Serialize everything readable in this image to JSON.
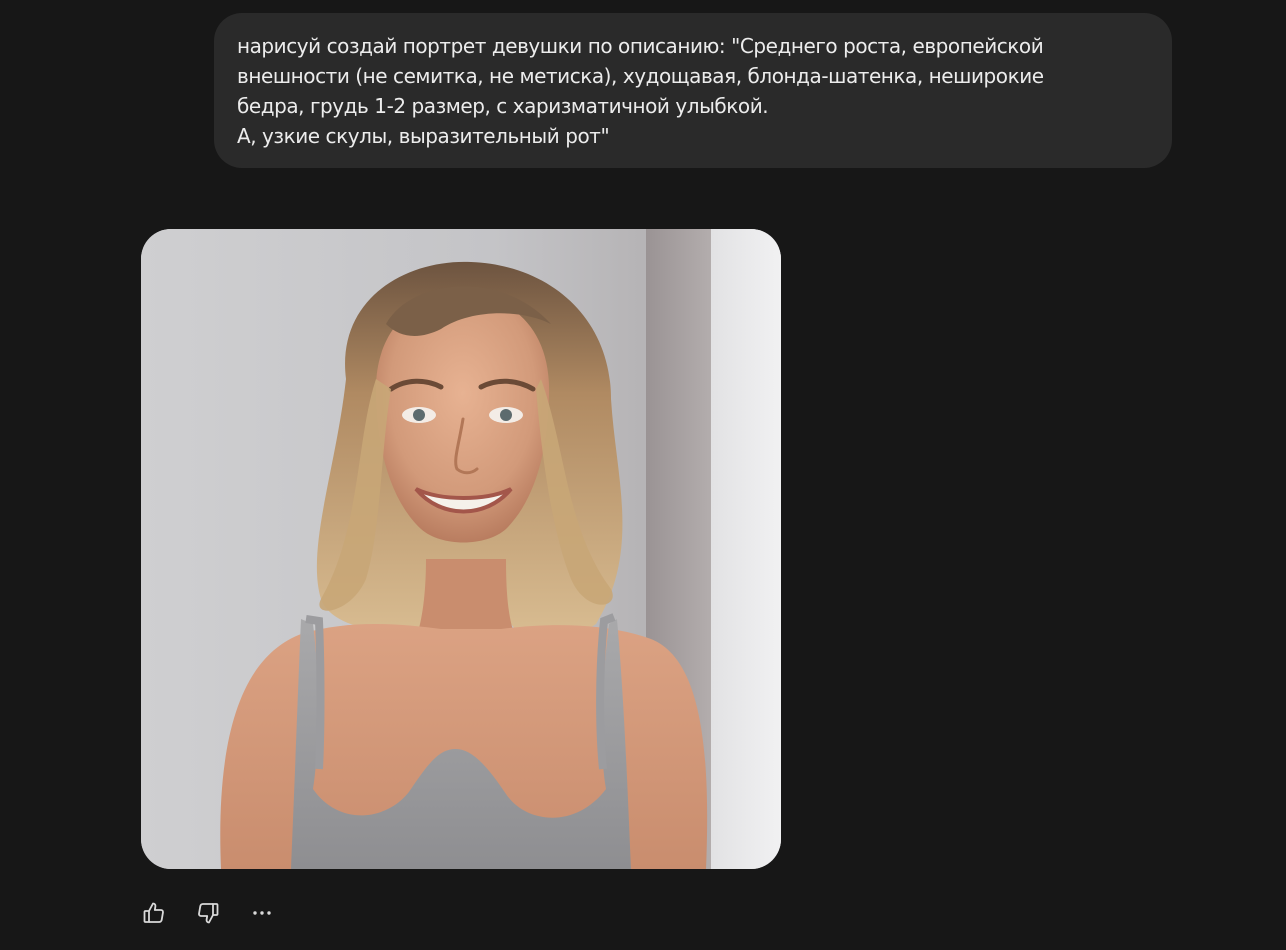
{
  "chat": {
    "user_message": {
      "lines": [
        "нарисуй создай портрет девушки по описанию: \"Среднего роста, европейской",
        "внешности (не семитка, не метиска), худощавая, блонда-шатенка, неширокие",
        "бедра, грудь 1-2 размер, с харизматичной улыбкой.",
        "А, узкие скулы, выразительный рот\""
      ]
    },
    "assistant_reply": {
      "image": {
        "subject": "photorealistic portrait of a smiling young woman with shoulder-length blonde-brown hair in a grey tank top against a light grey wall"
      },
      "actions": [
        {
          "name": "like",
          "icon": "thumbs-up-icon"
        },
        {
          "name": "dislike",
          "icon": "thumbs-down-icon"
        },
        {
          "name": "more",
          "icon": "more-horizontal-icon"
        }
      ]
    }
  },
  "colors": {
    "background": "#171717",
    "bubble": "#2a2a2a",
    "text": "#ececec",
    "icon": "#d9d9d9"
  }
}
